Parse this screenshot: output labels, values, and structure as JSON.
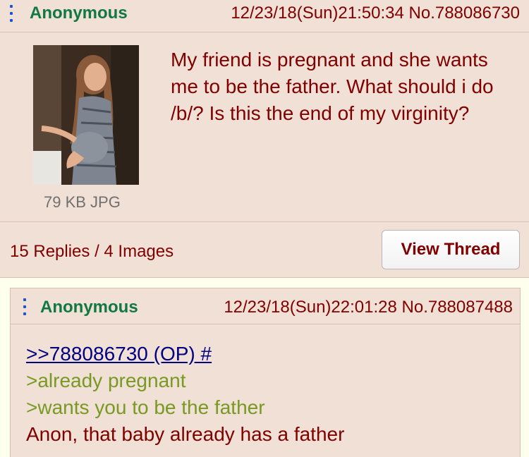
{
  "op": {
    "name": "Anonymous",
    "datetime": "12/23/18(Sun)21:50:34",
    "number": "No.788086730",
    "file_info": "79 KB JPG",
    "text": "My friend is pregnant and she wants me to be the father. What should i do /b/? Is this the end of my virginity?",
    "replies_summary": "15 Replies / 4 Images",
    "view_thread_label": "View Thread"
  },
  "reply": {
    "name": "Anonymous",
    "datetime": "12/23/18(Sun)22:01:28",
    "number": "No.788087488",
    "quote_link": ">>788086730 (OP) #",
    "greentext_1": ">already pregnant",
    "greentext_2": ">wants you to be the father",
    "plain_line": "Anon, that baby already has a father"
  },
  "colors": {
    "post_bg": "#f0e0d6",
    "page_bg": "#ffffee",
    "name": "#117743",
    "text": "#800000",
    "greentext": "#789922",
    "quotelink": "#000080",
    "menu_dots": "#1f53d6"
  },
  "icons": {
    "menu": "vertical-dots-icon"
  }
}
